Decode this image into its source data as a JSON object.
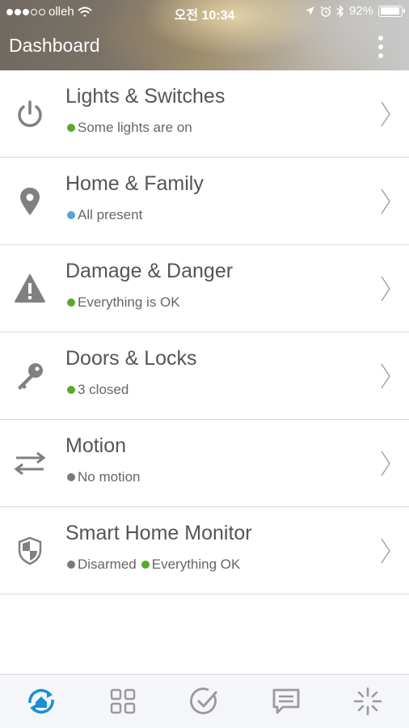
{
  "status_bar": {
    "carrier": "olleh",
    "time": "오전 10:34",
    "battery": "92%",
    "battery_level": 0.92
  },
  "header": {
    "title": "Dashboard",
    "menu_icon": "more-vertical-icon"
  },
  "colors": {
    "status_green": "#5aa82d",
    "status_blue": "#52a8d0",
    "status_gray": "#7a7a7a",
    "tab_active": "#1a8fd1",
    "tab_inactive": "#9a9a9a"
  },
  "rows": [
    {
      "title": "Lights & Switches",
      "icon": "power-icon",
      "status": [
        {
          "text": "Some lights are on",
          "color": "green"
        }
      ]
    },
    {
      "title": "Home & Family",
      "icon": "location-pin-icon",
      "status": [
        {
          "text": "All present",
          "color": "blue"
        }
      ]
    },
    {
      "title": "Damage & Danger",
      "icon": "warning-icon",
      "status": [
        {
          "text": "Everything is OK",
          "color": "green"
        }
      ]
    },
    {
      "title": "Doors & Locks",
      "icon": "key-icon",
      "status": [
        {
          "text": "3 closed",
          "color": "green"
        }
      ]
    },
    {
      "title": "Motion",
      "icon": "motion-arrows-icon",
      "status": [
        {
          "text": "No motion",
          "color": "gray"
        }
      ]
    },
    {
      "title": "Smart Home Monitor",
      "icon": "shield-icon",
      "status": [
        {
          "text": "Disarmed",
          "color": "gray"
        },
        {
          "text": "Everything OK",
          "color": "green"
        }
      ]
    }
  ],
  "tabs": [
    {
      "name": "dashboard",
      "icon": "home-sync-icon",
      "active": true
    },
    {
      "name": "things",
      "icon": "grid-icon",
      "active": false
    },
    {
      "name": "routines",
      "icon": "check-circle-icon",
      "active": false
    },
    {
      "name": "notifications",
      "icon": "message-icon",
      "active": false
    },
    {
      "name": "marketplace",
      "icon": "sparkle-icon",
      "active": false
    }
  ]
}
